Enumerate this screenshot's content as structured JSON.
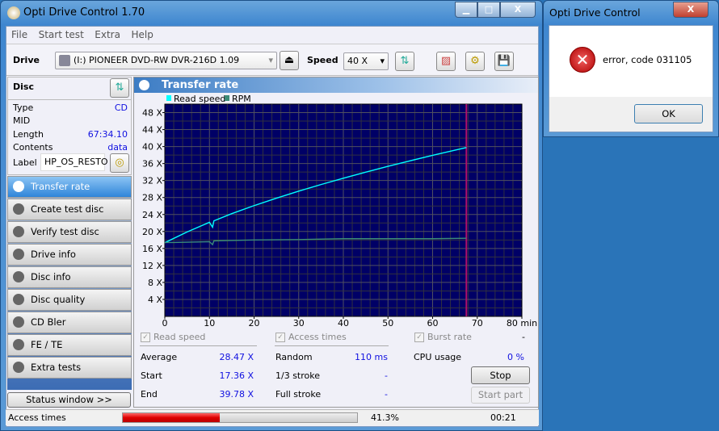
{
  "window": {
    "title": "Opti Drive Control 1.70",
    "minimize": "▁",
    "maximize": "□",
    "close": "X"
  },
  "menu": [
    "File",
    "Start test",
    "Extra",
    "Help"
  ],
  "toolbar": {
    "drive_label": "Drive",
    "drive_value": "(I:)   PIONEER DVD-RW  DVR-216D 1.09",
    "speed_label": "Speed",
    "speed_value": "40 X"
  },
  "disc": {
    "title": "Disc",
    "rows": [
      {
        "k": "Type",
        "v": "CD"
      },
      {
        "k": "MID",
        "v": ""
      },
      {
        "k": "Length",
        "v": "67:34.10"
      },
      {
        "k": "Contents",
        "v": "data"
      }
    ],
    "label_key": "Label",
    "label_value": "HP_OS_RESTO"
  },
  "nav": [
    "Transfer rate",
    "Create test disc",
    "Verify test disc",
    "Drive info",
    "Disc info",
    "Disc quality",
    "CD Bler",
    "FE / TE",
    "Extra tests"
  ],
  "status_window_button": "Status window >>",
  "panel_title": "Transfer rate",
  "chart_data": {
    "type": "line",
    "legend": [
      "Read speed",
      "RPM"
    ],
    "legend_position": "top-left",
    "xlabel_unit": "min",
    "ylabel_unit": "X",
    "xlim": [
      0,
      80
    ],
    "ylim": [
      0,
      50
    ],
    "x_ticks": [
      0,
      10,
      20,
      30,
      40,
      50,
      60,
      70,
      80
    ],
    "y_ticks": [
      4,
      8,
      12,
      16,
      20,
      24,
      28,
      32,
      36,
      40,
      44,
      48
    ],
    "grid": true,
    "colors": {
      "background": "#000066",
      "read_speed": "#00ffff",
      "rpm": "#3c8c78",
      "marker": "#b0106a",
      "grid": "#404040"
    },
    "end_marker_x": 67.57,
    "series": [
      {
        "name": "Read speed",
        "x": [
          0,
          5,
          10,
          10.7,
          11,
          15,
          20,
          25,
          30,
          35,
          40,
          45,
          50,
          55,
          60,
          65,
          67.57
        ],
        "y": [
          17.36,
          19.9,
          22.16,
          21.0,
          22.5,
          24.2,
          26.09,
          27.84,
          29.5,
          31.06,
          32.55,
          33.98,
          35.35,
          36.66,
          37.93,
          39.16,
          39.78
        ]
      },
      {
        "name": "RPM",
        "x": [
          0,
          2,
          10,
          10.7,
          11,
          20,
          30,
          40,
          50,
          60,
          67.57
        ],
        "y": [
          17.4,
          17.4,
          17.6,
          16.9,
          17.8,
          18.0,
          18.1,
          18.3,
          18.3,
          18.3,
          18.4
        ]
      }
    ]
  },
  "stats": {
    "read_speed": "Read speed",
    "access_times": "Access times",
    "burst_rate": "Burst rate",
    "burst_value": "-",
    "average_k": "Average",
    "average_v": "28.47 X",
    "start_k": "Start",
    "start_v": "17.36 X",
    "end_k": "End",
    "end_v": "39.78 X",
    "random_k": "Random",
    "random_v": "110 ms",
    "third_k": "1/3 stroke",
    "third_v": "-",
    "full_k": "Full stroke",
    "full_v": "-",
    "cpu_k": "CPU usage",
    "cpu_v": "0 %",
    "stop": "Stop",
    "start_part": "Start part"
  },
  "statusbar": {
    "text": "Access times",
    "progress": 41.3,
    "progress_text": "41.3%",
    "time": "00:21"
  },
  "dialog": {
    "title": "Opti Drive Control",
    "close": "X",
    "message": "error, code 031105",
    "ok": "OK"
  }
}
